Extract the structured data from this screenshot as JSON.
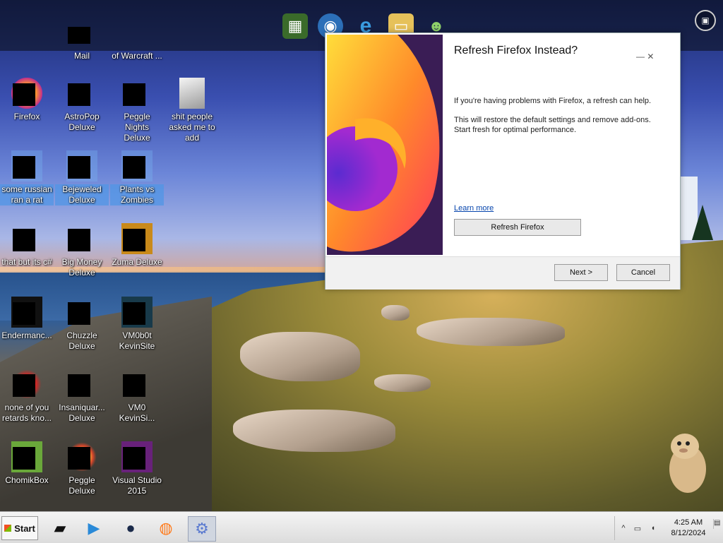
{
  "desktop_icons": [
    {
      "label": "Mail"
    },
    {
      "label": "of Warcraft ..."
    },
    {
      "label": "Firefox"
    },
    {
      "label": "AstroPop Deluxe"
    },
    {
      "label": "Peggle Nights Deluxe"
    },
    {
      "label": "shit people asked me to add"
    },
    {
      "label": "some russian ran a rat"
    },
    {
      "label": "Bejeweled Deluxe"
    },
    {
      "label": "Plants vs Zombies"
    },
    {
      "label": "that but its c#"
    },
    {
      "label": "Big Money Deluxe"
    },
    {
      "label": "Zuma Deluxe"
    },
    {
      "label": "Endermanc..."
    },
    {
      "label": "Chuzzle Deluxe"
    },
    {
      "label": "VM0b0t KevinSite"
    },
    {
      "label": "none of you retards kno..."
    },
    {
      "label": "Insaniquar... Deluxe"
    },
    {
      "label": "VM0 KevinSi..."
    },
    {
      "label": "ChomikBox"
    },
    {
      "label": "Peggle Deluxe"
    },
    {
      "label": "Visual Studio 2015"
    }
  ],
  "dialog": {
    "title": "Refresh Firefox Instead?",
    "line1": "If you're having problems with Firefox, a refresh can help.",
    "line2": "This will restore the default settings and remove add-ons. Start fresh for optimal performance.",
    "learn_more": "Learn more",
    "refresh_button": "Refresh Firefox",
    "next_button": "Next >",
    "cancel_button": "Cancel",
    "window_controls": "—   ✕"
  },
  "taskbar": {
    "start_label": "Start",
    "clock_time": "4:25 AM",
    "clock_date": "8/12/2024"
  },
  "icons": {
    "dock": [
      "minecraft-icon",
      "network-globe-icon",
      "internet-explorer-icon",
      "folder-icon",
      "users-icon"
    ],
    "tray": [
      "chevron-up-icon",
      "monitor-icon",
      "volume-icon"
    ]
  }
}
